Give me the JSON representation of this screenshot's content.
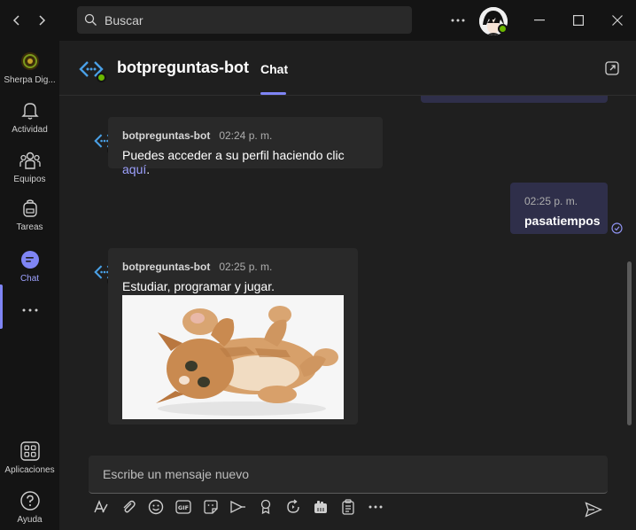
{
  "search": {
    "placeholder": "Buscar"
  },
  "rail": {
    "items": [
      {
        "label": "Sherpa Dig..."
      },
      {
        "label": "Actividad"
      },
      {
        "label": "Equipos"
      },
      {
        "label": "Tareas"
      },
      {
        "label": "Chat"
      },
      {
        "label": "Aplicaciones"
      },
      {
        "label": "Ayuda"
      }
    ]
  },
  "header": {
    "title": "botpreguntas-bot",
    "tab": "Chat"
  },
  "messages": [
    {
      "sender": "botpreguntas-bot",
      "time": "02:24 p. m.",
      "text": "Puedes acceder a su perfil haciendo clic ",
      "link": "aquí",
      "suffix": "."
    },
    {
      "sender": "",
      "time": "02:25 p. m.",
      "text": "pasatiempos"
    },
    {
      "sender": "botpreguntas-bot",
      "time": "02:25 p. m.",
      "text": "Estudiar, programar y jugar."
    }
  ],
  "compose": {
    "placeholder": "Escribe un mensaje nuevo"
  },
  "colors": {
    "accent": "#7f85f5",
    "presence": "#6bb700",
    "link": "#9ea2ff"
  }
}
